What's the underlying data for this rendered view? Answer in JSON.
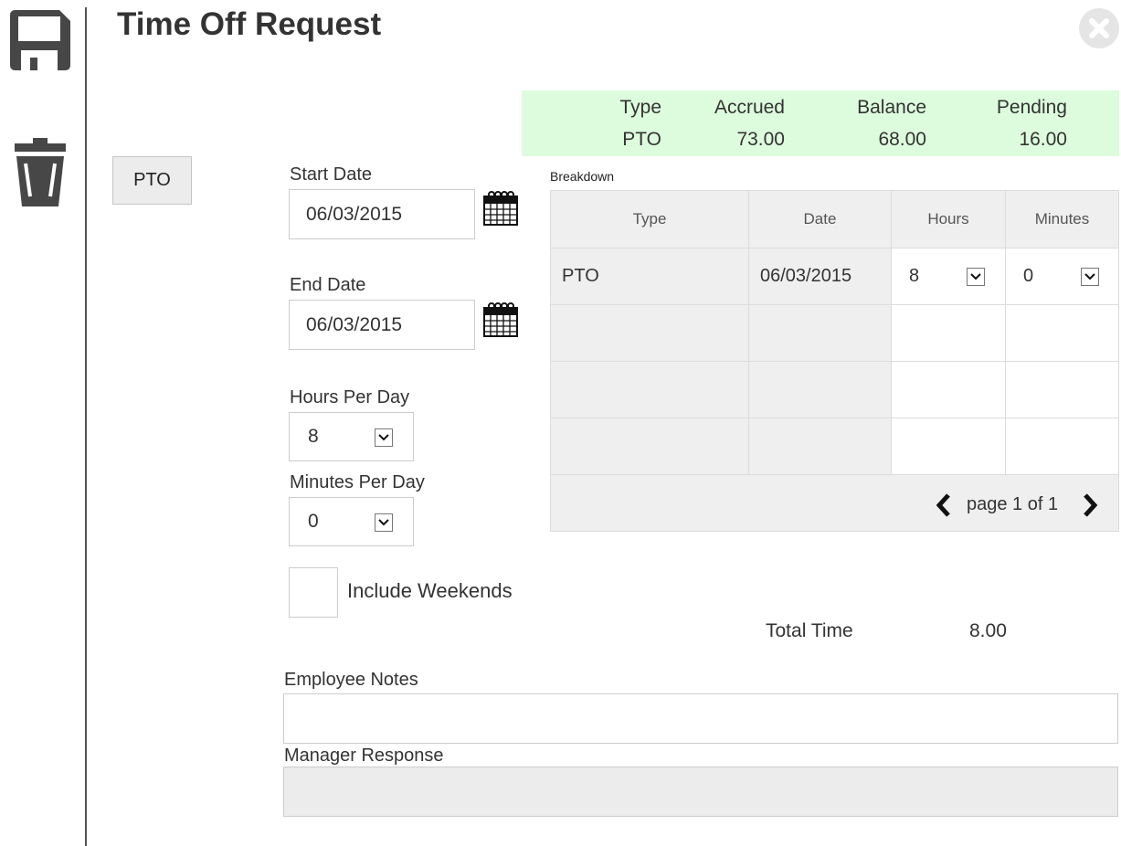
{
  "header": {
    "title": "Time Off Request"
  },
  "toolbar": {
    "save_icon": "floppy-disk-icon",
    "delete_icon": "trash-can-icon",
    "close_icon": "close-circle-icon"
  },
  "leave_type_button": "PTO",
  "summary": {
    "headers": [
      "Type",
      "Accrued",
      "Balance",
      "Pending"
    ],
    "values": [
      "PTO",
      "73.00",
      "68.00",
      "16.00"
    ],
    "background": "#ddfcdd"
  },
  "form": {
    "start_date_label": "Start Date",
    "start_date_value": "06/03/2015",
    "end_date_label": "End Date",
    "end_date_value": "06/03/2015",
    "hours_per_day_label": "Hours Per Day",
    "hours_per_day_value": "8",
    "minutes_per_day_label": "Minutes Per Day",
    "minutes_per_day_value": "0",
    "include_weekends_label": "Include Weekends",
    "include_weekends_checked": false
  },
  "breakdown": {
    "label": "Breakdown",
    "columns": [
      "Type",
      "Date",
      "Hours",
      "Minutes"
    ],
    "rows": [
      {
        "type": "PTO",
        "date": "06/03/2015",
        "hours": "8",
        "minutes": "0"
      }
    ],
    "pager_text": "page 1 of 1"
  },
  "totals": {
    "label": "Total Time",
    "value": "8.00"
  },
  "notes": {
    "employee_label": "Employee Notes",
    "employee_value": "",
    "manager_label": "Manager Response",
    "manager_value": ""
  }
}
